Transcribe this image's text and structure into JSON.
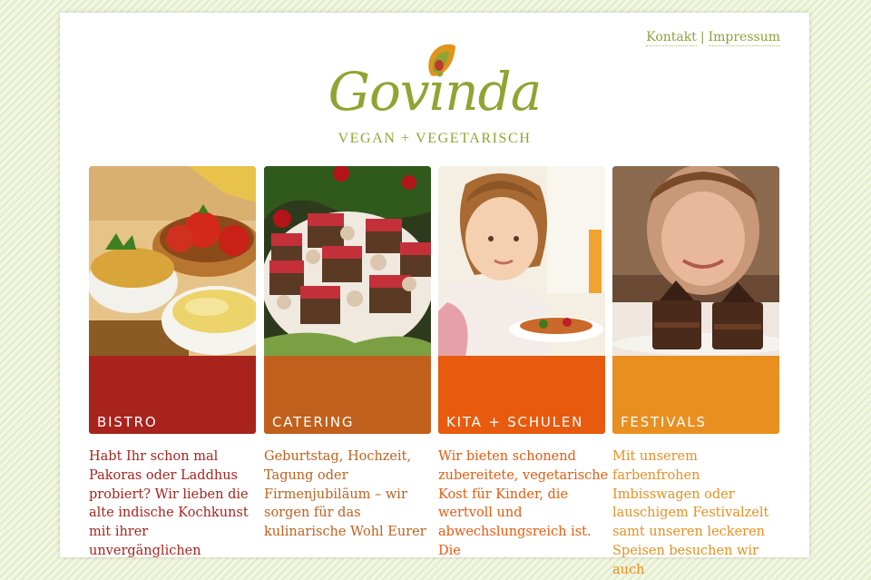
{
  "nav": {
    "contact": "Kontakt",
    "separator": "|",
    "imprint": "Impressum"
  },
  "brand": {
    "name": "Govinda",
    "tagline": "VEGAN + VEGETARISCH",
    "color": "#8fa532"
  },
  "cards": [
    {
      "title": "BISTRO",
      "color": "#a8231c",
      "text": "Habt Ihr schon mal Pakoras oder Laddhus probiert? Wir lieben die alte indische Kochkunst mit ihrer unvergänglichen"
    },
    {
      "title": "CATERING",
      "color": "#c0601c",
      "text": "Geburtstag, Hochzeit, Tagung oder Firmenjubiläum – wir sorgen für das kulinarische Wohl Eurer"
    },
    {
      "title": "KITA + SCHULEN",
      "color": "#e85a0d",
      "text": "Wir bieten schonend zubereitete, vegetarische Kost für Kinder, die wertvoll und abwechslungsreich ist. Die"
    },
    {
      "title": "FESTIVALS",
      "color": "#e88f20",
      "text": "Mit unserem farbenfrohen Imbisswagen oder lauschigem Festivalzelt samt unseren leckeren Speisen besuchen wir auch"
    }
  ]
}
